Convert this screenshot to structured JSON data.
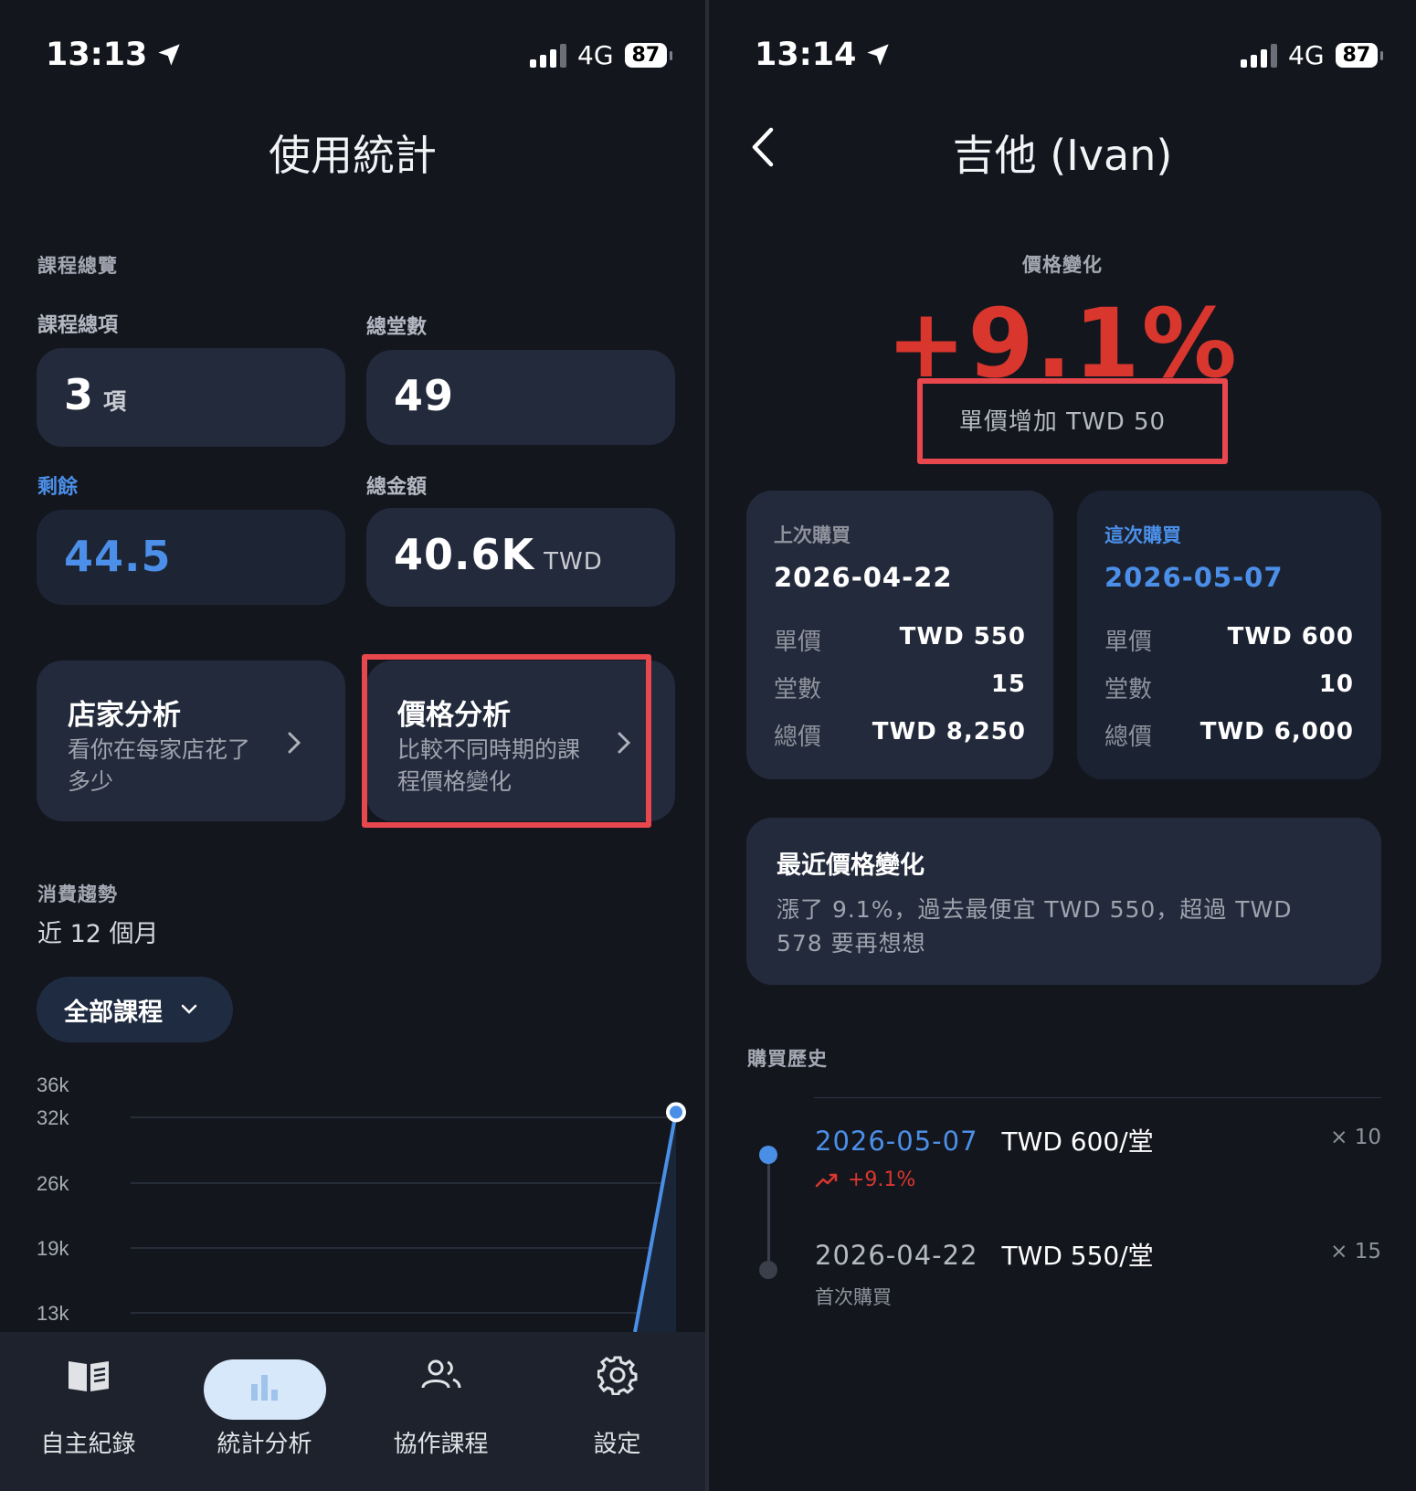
{
  "left": {
    "status": {
      "time": "13:13",
      "network": "4G",
      "battery": "87"
    },
    "title": "使用統計",
    "overview": {
      "section_label": "課程總覽",
      "total_items_label": "課程總項",
      "total_items_value": "3",
      "total_items_unit": "項",
      "total_sessions_label": "總堂數",
      "total_sessions_value": "49",
      "remaining_label": "剩餘",
      "remaining_value": "44.5",
      "total_amount_label": "總金額",
      "total_amount_value": "40.6K",
      "total_amount_unit": "TWD"
    },
    "store_analysis": {
      "title": "店家分析",
      "subtitle_1": "看你在每家店花了",
      "subtitle_2": "多少"
    },
    "price_analysis": {
      "title": "價格分析",
      "subtitle_1": "比較不同時期的課",
      "subtitle_2": "程價格變化"
    },
    "trend": {
      "section_label": "消費趨勢",
      "period": "近 12 個月",
      "filter": "全部課程"
    },
    "chart_data": {
      "type": "line",
      "title": "",
      "xlabel": "",
      "ylabel": "",
      "y_tick_labels": [
        "36k",
        "32k",
        "26k",
        "19k",
        "13k"
      ],
      "y_ticks": [
        36000,
        32000,
        26000,
        19000,
        13000
      ],
      "ylim": [
        13000,
        36000
      ],
      "grid": true,
      "series": [
        {
          "values": [
            0,
            0,
            0,
            0,
            0,
            0,
            0,
            0,
            0,
            0,
            0,
            32500
          ]
        }
      ],
      "color": "#4a8fe6"
    },
    "tabs": [
      {
        "label": "自主紀錄",
        "icon": "book-icon"
      },
      {
        "label": "統計分析",
        "icon": "bar-chart-icon",
        "active": true
      },
      {
        "label": "協作課程",
        "icon": "people-icon"
      },
      {
        "label": "設定",
        "icon": "gear-icon"
      }
    ]
  },
  "right": {
    "status": {
      "time": "13:14",
      "network": "4G",
      "battery": "87"
    },
    "title": "吉他 (Ivan)",
    "price_change_label": "價格變化",
    "price_change_value": "+9.1%",
    "unit_price_increase": "單價增加 TWD 50",
    "last_purchase": {
      "label": "上次購買",
      "date": "2026-04-22",
      "unit_price_key": "單價",
      "unit_price": "TWD 550",
      "sessions_key": "堂數",
      "sessions": "15",
      "total_key": "總價",
      "total": "TWD 8,250"
    },
    "this_purchase": {
      "label": "這次購買",
      "date": "2026-05-07",
      "unit_price_key": "單價",
      "unit_price": "TWD 600",
      "sessions_key": "堂數",
      "sessions": "10",
      "total_key": "總價",
      "total": "TWD 6,000"
    },
    "recent_change": {
      "title": "最近價格變化",
      "text_1": "漲了 9.1%，過去最便宜 TWD 550，超過 TWD",
      "text_2": "578 要再想想"
    },
    "history": {
      "section_label": "購買歷史",
      "items": [
        {
          "date": "2026-05-07",
          "price": "TWD 600/堂",
          "qty": "× 10",
          "note": "+9.1%"
        },
        {
          "date": "2026-04-22",
          "price": "TWD 550/堂",
          "qty": "× 15",
          "note": "首次購買"
        }
      ]
    },
    "colors": {
      "accent_blue": "#4a8fe6",
      "increase_red": "#d9362e",
      "highlight_box": "#e8474e"
    }
  }
}
